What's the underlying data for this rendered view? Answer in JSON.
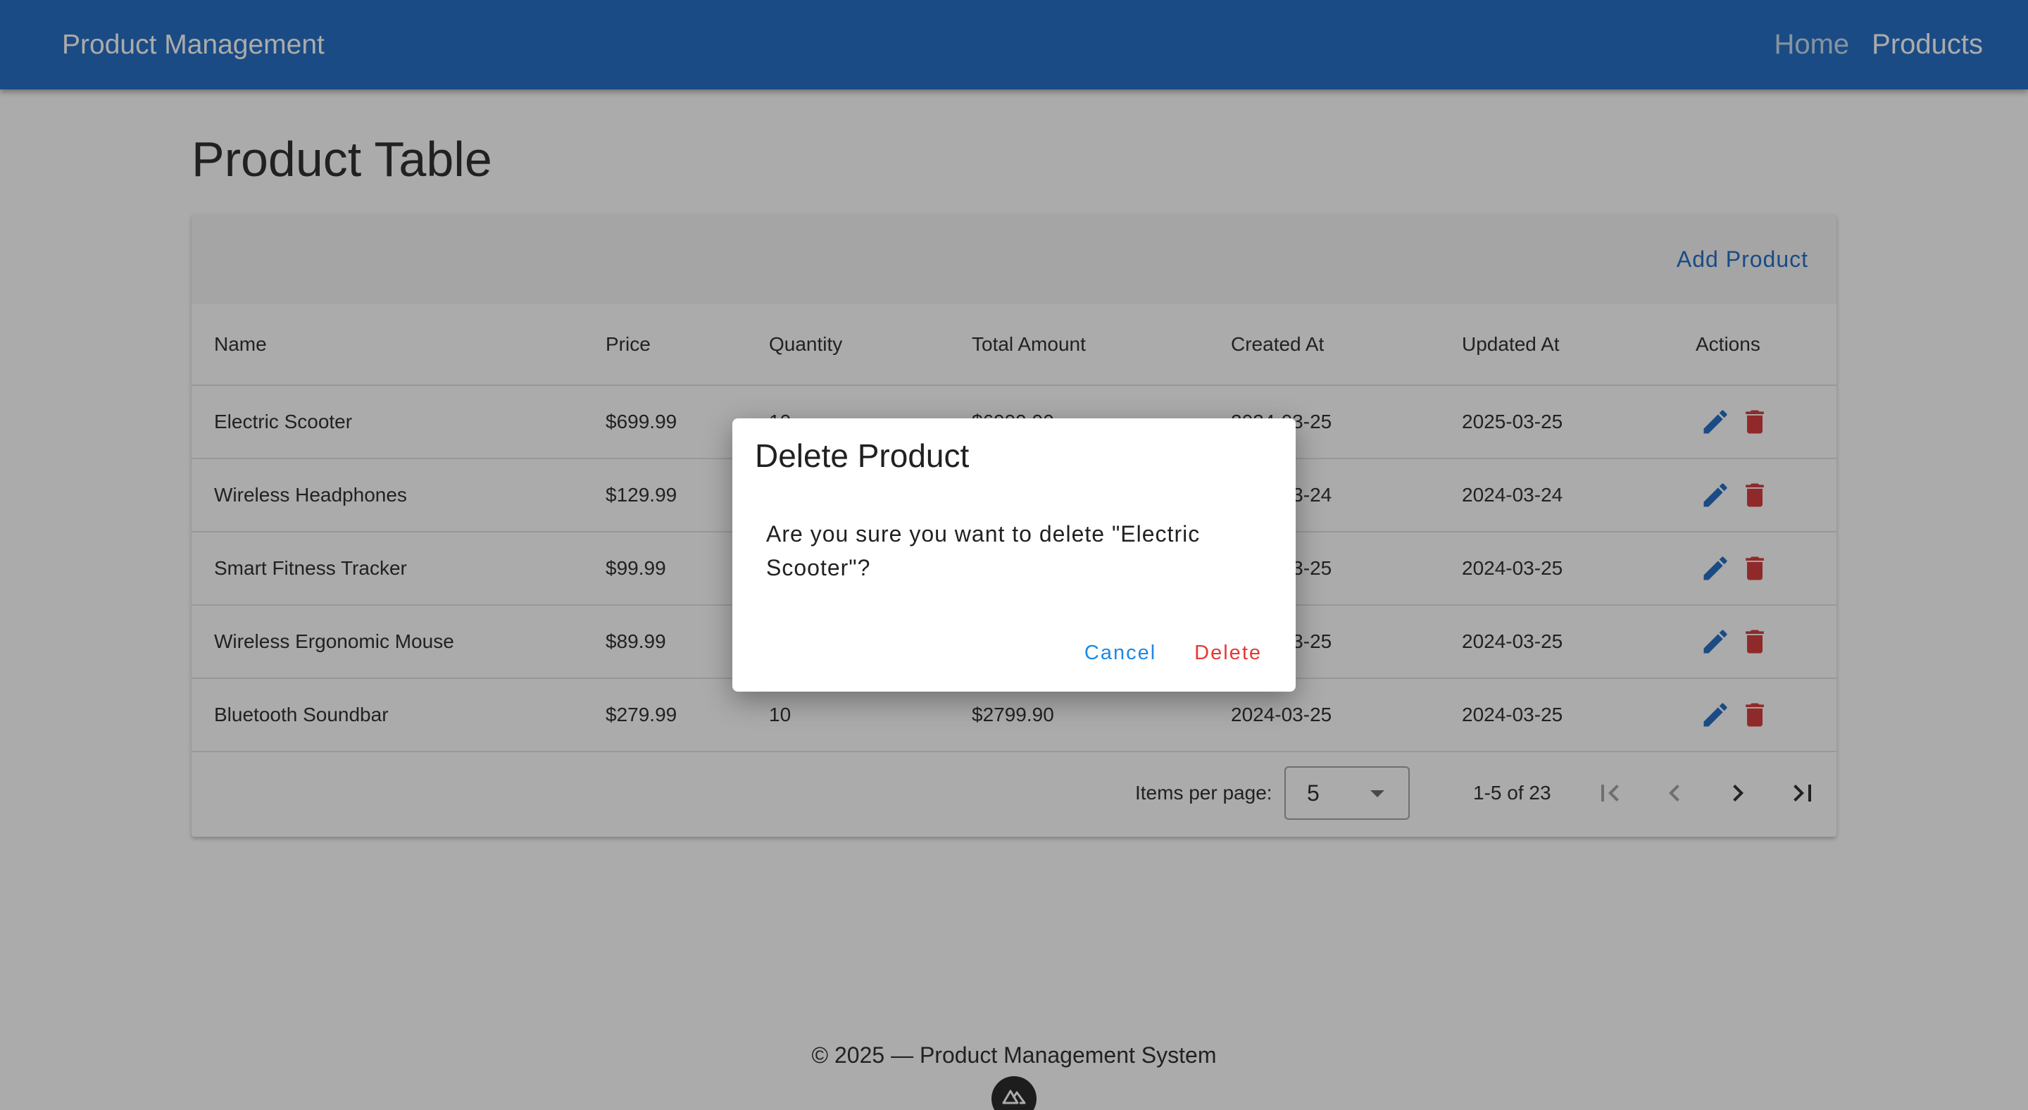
{
  "appbar": {
    "title": "Product Management",
    "nav": [
      {
        "label": "Home",
        "active": false
      },
      {
        "label": "Products",
        "active": true
      }
    ],
    "color": "#1565c0"
  },
  "main": {
    "page_title": "Product Table",
    "add_label": "Add Product"
  },
  "table": {
    "columns": [
      "Name",
      "Price",
      "Quantity",
      "Total Amount",
      "Created At",
      "Updated At",
      "Actions"
    ],
    "rows": [
      {
        "name": "Electric Scooter",
        "price": "$699.99",
        "quantity": "10",
        "total": "$6999.90",
        "created": "2024-03-25",
        "updated": "2025-03-25"
      },
      {
        "name": "Wireless Headphones",
        "price": "$129.99",
        "quantity": "",
        "total": "",
        "created": "2024-03-24",
        "updated": "2024-03-24"
      },
      {
        "name": "Smart Fitness Tracker",
        "price": "$99.99",
        "quantity": "",
        "total": "",
        "created": "2024-03-25",
        "updated": "2024-03-25"
      },
      {
        "name": "Wireless Ergonomic Mouse",
        "price": "$89.99",
        "quantity": "",
        "total": "",
        "created": "2024-03-25",
        "updated": "2024-03-25"
      },
      {
        "name": "Bluetooth Soundbar",
        "price": "$279.99",
        "quantity": "10",
        "total": "$2799.90",
        "created": "2024-03-25",
        "updated": "2024-03-25"
      }
    ],
    "action_icons": {
      "edit": "pencil-icon",
      "delete": "trash-icon",
      "edit_color": "#1565c0",
      "delete_color": "#d32f2f"
    }
  },
  "pagination": {
    "items_per_page_label": "Items per page:",
    "items_per_page_value": "5",
    "range": "1-5 of 23",
    "icons": [
      "first-page-icon",
      "prev-page-icon",
      "next-page-icon",
      "last-page-icon"
    ]
  },
  "footer": {
    "text": "© 2025 — Product Management System"
  },
  "dialog": {
    "title": "Delete Product",
    "message": "Are you sure you want to delete \"Electric Scooter\"?",
    "cancel_label": "Cancel",
    "delete_label": "Delete",
    "cancel_color": "#1e88e5",
    "delete_color": "#e53935"
  }
}
